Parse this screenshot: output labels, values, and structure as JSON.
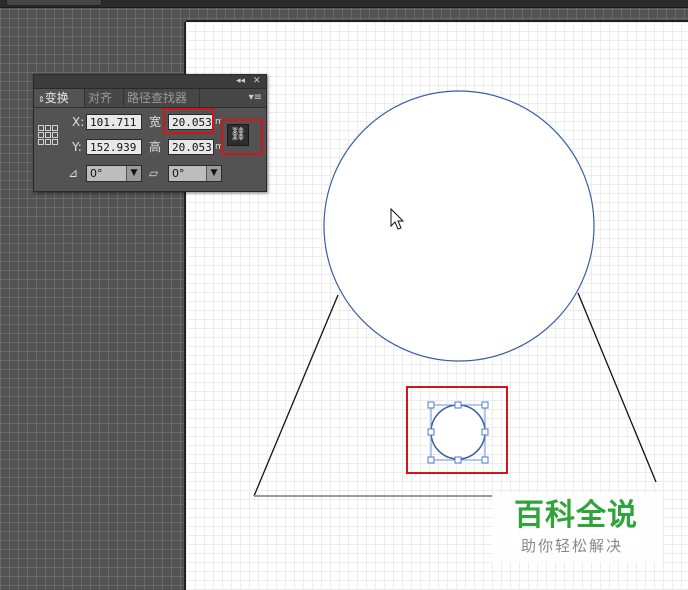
{
  "panel": {
    "tabs": [
      "变换",
      "对齐",
      "路径查找器"
    ],
    "x_label": "X:",
    "x_value": "101.711",
    "y_label": "Y:",
    "y_value": "152.939",
    "width_label": "宽",
    "width_value": "20.053",
    "height_label": "高",
    "height_value": "20.053",
    "unit": "m",
    "rotate_icon": "angle-icon",
    "rotate_value": "0°",
    "shear_icon": "shear-icon",
    "shear_value": "0°",
    "constrain_icon": "link-icon",
    "collapse_glyph": "◂◂",
    "close_glyph": "✕",
    "menu_glyph": "▾≡",
    "dropdown_glyph": "▼"
  },
  "watermark": {
    "title": "百科全说",
    "subtitle": "助你轻松解决"
  },
  "colors": {
    "highlight": "#d0161b",
    "path_blue": "#3a5ca8",
    "watermark_green": "#2ea43a"
  }
}
